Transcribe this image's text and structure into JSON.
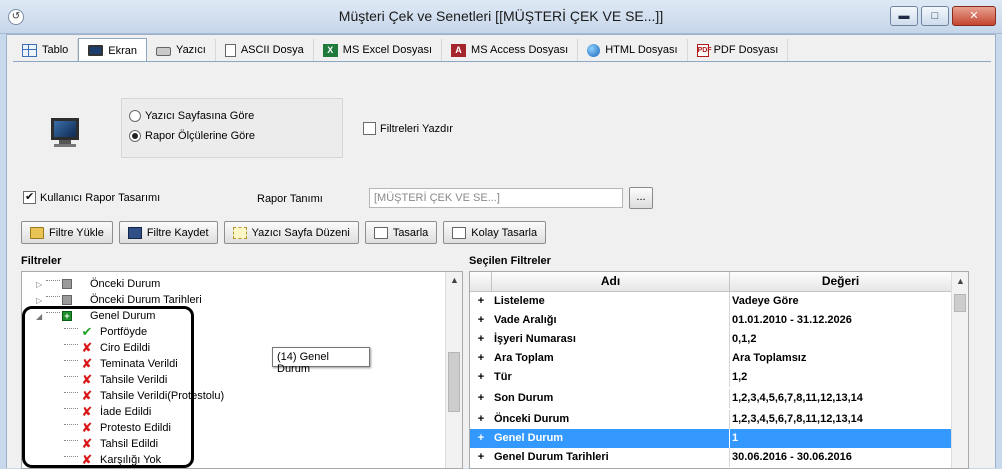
{
  "window": {
    "title": "Müşteri Çek ve Senetleri [[MÜŞTERİ ÇEK VE SE...]]",
    "minimize": "▬",
    "maximize": "□",
    "close": "✕"
  },
  "tabs": [
    {
      "label": "Tablo",
      "icon": "table-icon"
    },
    {
      "label": "Ekran",
      "icon": "monitor-icon",
      "active": true
    },
    {
      "label": "Yazıcı",
      "icon": "printer-icon"
    },
    {
      "label": "ASCII Dosya",
      "icon": "text-file-icon"
    },
    {
      "label": "MS Excel Dosyası",
      "icon": "excel-icon"
    },
    {
      "label": "MS Access Dosyası",
      "icon": "access-icon"
    },
    {
      "label": "HTML Dosyası",
      "icon": "globe-icon"
    },
    {
      "label": "PDF Dosyası",
      "icon": "pdf-icon"
    }
  ],
  "output_options": {
    "radio_printer_page": "Yazıcı Sayfasına Göre",
    "radio_report_size": "Rapor Ölçülerine Göre",
    "selected": "Rapor Ölçülerine Göre",
    "print_filters_label": "Filtreleri Yazdır",
    "print_filters_checked": false
  },
  "report": {
    "user_design_label": "Kullanıcı Rapor Tasarımı",
    "user_design_checked": true,
    "definition_label": "Rapor Tanımı",
    "definition_value": "[MÜŞTERİ ÇEK VE SE...]",
    "browse_label": "..."
  },
  "toolbar": {
    "load_filter": "Filtre Yükle",
    "save_filter": "Filtre Kaydet",
    "page_setup": "Yazıcı Sayfa Düzeni",
    "design": "Tasarla",
    "easy_design": "Kolay Tasarla"
  },
  "filters_panel": {
    "title": "Filtreler",
    "tree": [
      {
        "label": "Önceki Durum",
        "level": 0,
        "type": "node"
      },
      {
        "label": "Önceki Durum Tarihleri",
        "level": 0,
        "type": "node"
      },
      {
        "label": "Genel Durum",
        "level": 0,
        "type": "expanded"
      },
      {
        "label": "Portföyde",
        "level": 1,
        "type": "checked"
      },
      {
        "label": "Ciro Edildi",
        "level": 1,
        "type": "unchecked"
      },
      {
        "label": "Teminata Verildi",
        "level": 1,
        "type": "unchecked"
      },
      {
        "label": "Tahsile Verildi",
        "level": 1,
        "type": "unchecked"
      },
      {
        "label": "Tahsile Verildi(Protestolu)",
        "level": 1,
        "type": "unchecked"
      },
      {
        "label": "İade Edildi",
        "level": 1,
        "type": "unchecked"
      },
      {
        "label": "Protesto Edildi",
        "level": 1,
        "type": "unchecked"
      },
      {
        "label": "Tahsil Edildi",
        "level": 1,
        "type": "unchecked"
      },
      {
        "label": "Karşılığı Yok",
        "level": 1,
        "type": "unchecked"
      }
    ],
    "tooltip": "(14) Genel Durum"
  },
  "selected_panel": {
    "title": "Seçilen Filtreler",
    "columns": [
      "Adı",
      "Değeri"
    ],
    "rows": [
      {
        "name": "Listeleme",
        "value": "Vadeye Göre"
      },
      {
        "name": "Vade Aralığı",
        "value": "01.01.2010 - 31.12.2026"
      },
      {
        "name": "İşyeri Numarası",
        "value": "0,1,2"
      },
      {
        "name": "Ara Toplam",
        "value": "Ara Toplamsız"
      },
      {
        "name": "Tür",
        "value": "1,2"
      },
      {
        "name": "Son Durum",
        "value": "1,2,3,4,5,6,7,8,11,12,13,14"
      },
      {
        "name": "Önceki Durum",
        "value": "1,2,3,4,5,6,7,8,11,12,13,14"
      },
      {
        "name": "Genel Durum",
        "value": "1",
        "selected": true
      },
      {
        "name": "Genel Durum Tarihleri",
        "value": "30.06.2016 - 30.06.2016"
      }
    ],
    "expand_symbol": "+"
  },
  "colors": {
    "selection": "#3399ff",
    "check_ok": "#24a52b",
    "check_no": "#d81616"
  }
}
